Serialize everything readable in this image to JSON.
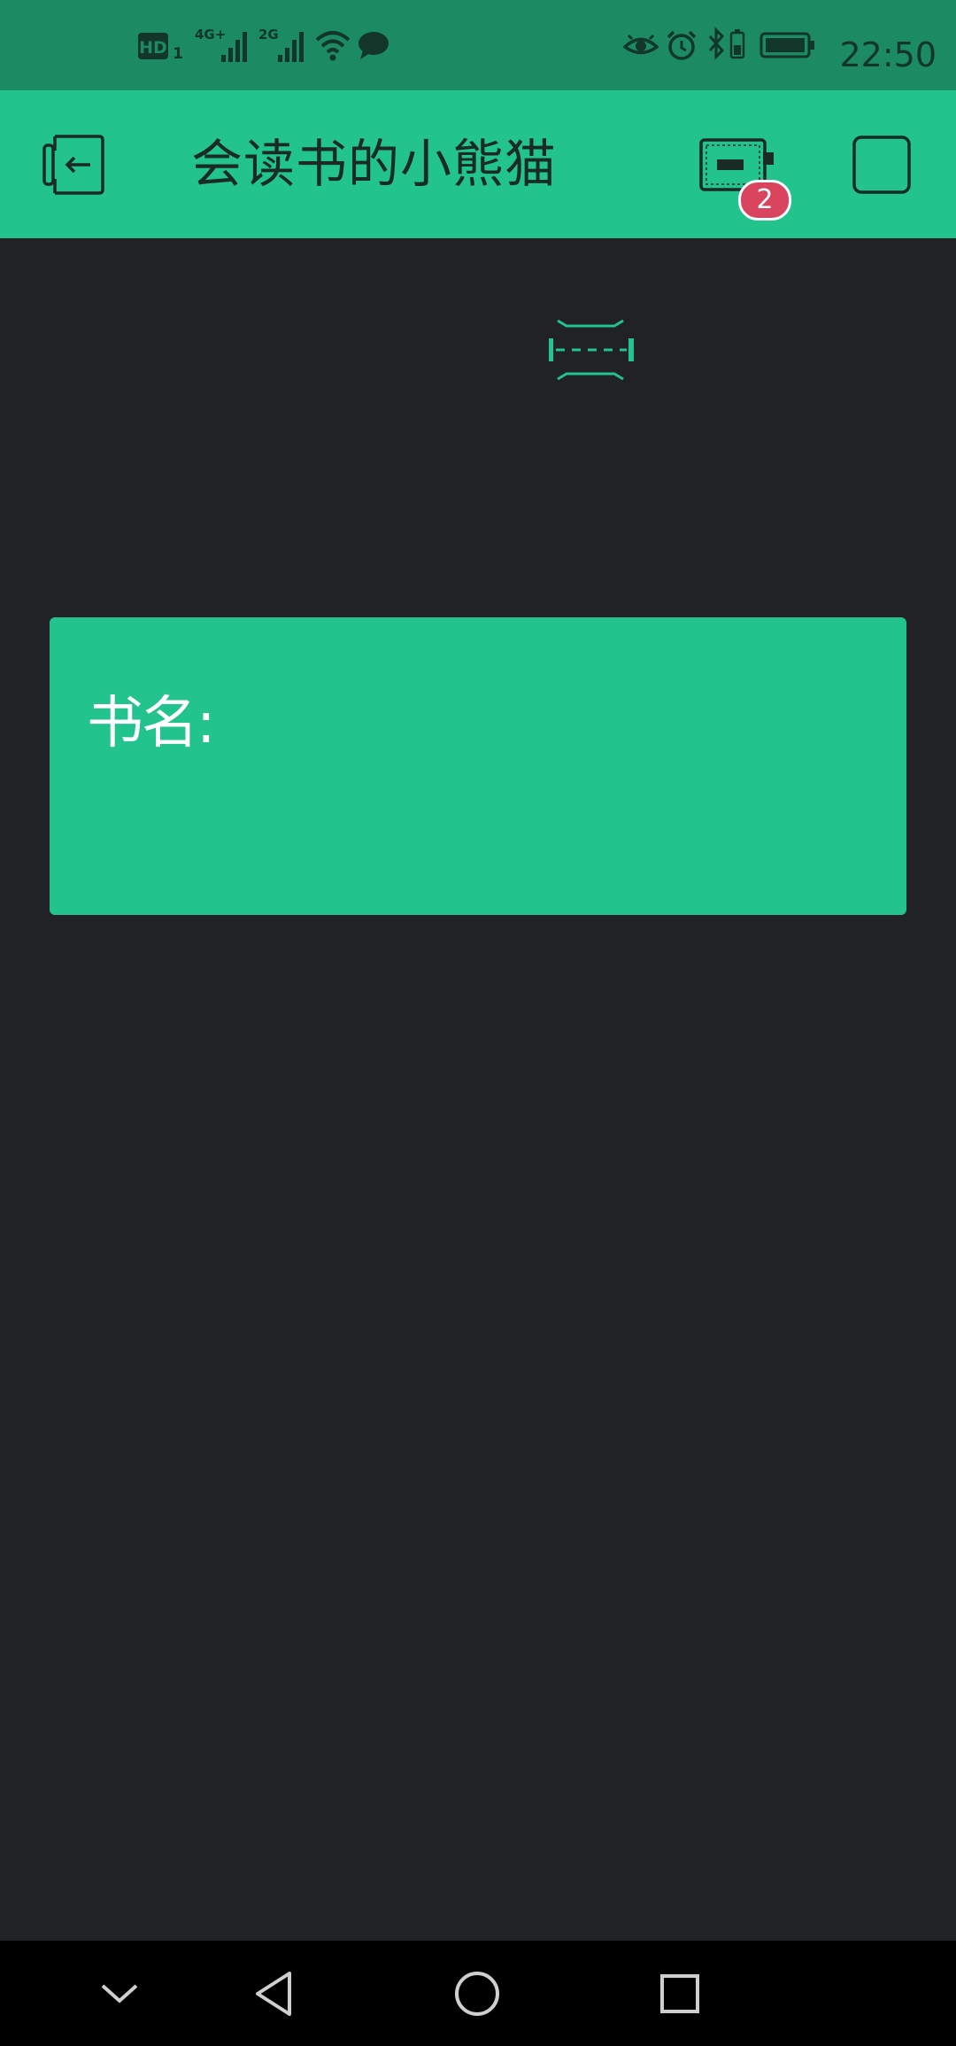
{
  "status_bar": {
    "time": "22:50",
    "left_icons": [
      "hd-icon",
      "signal-4g-icon",
      "signal-2g-icon",
      "wifi-icon",
      "chat-bubble-icon"
    ],
    "right_icons": [
      "eye-icon",
      "alarm-icon",
      "bluetooth-icon",
      "battery-icon"
    ],
    "hd_label": "HD",
    "sim_label": "1",
    "net1_label": "4G+",
    "net2_label": "2G"
  },
  "app_bar": {
    "title": "会读书的小熊猫",
    "badge_count": "2",
    "left_icon": "exit-icon",
    "right_icons": [
      "device-icon",
      "square-icon"
    ]
  },
  "card": {
    "label": "书名:"
  },
  "nav_bar": {
    "buttons": [
      "chevron-down-icon",
      "back-icon",
      "home-icon",
      "recents-icon"
    ]
  },
  "colors": {
    "accent": "#22c38c",
    "status_bar": "#1c8a63",
    "background": "#202226",
    "badge": "#d9455f"
  }
}
